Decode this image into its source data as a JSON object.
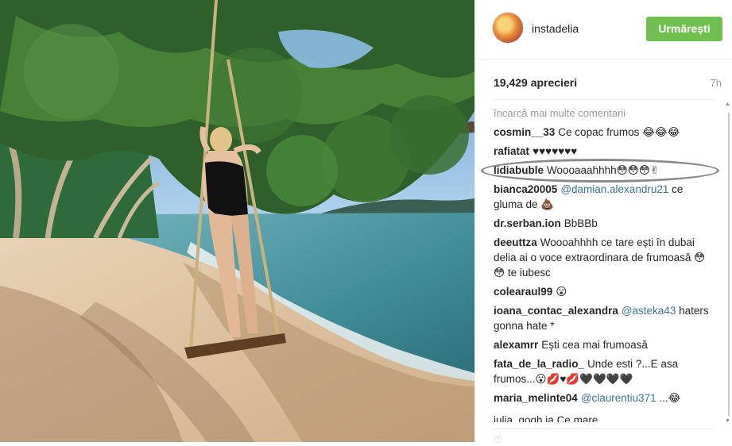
{
  "post": {
    "username": "instadelia",
    "follow_label": "Urmărești",
    "likes": "19,429 aprecieri",
    "time_ago": "7h",
    "load_more": "încarcă mai multe comentarii"
  },
  "comments": [
    {
      "user": "cosmin__33",
      "text": "Ce copac frumos 😂😂😂"
    },
    {
      "user": "rafiatat",
      "text": "♥♥♥♥♥♥♥"
    },
    {
      "user": "lidiabuble",
      "text": "Woooaaahhhh😳😳😳✌"
    },
    {
      "user": "bianca20005",
      "mention": "@damian.alexandru21",
      "text": "ce gluma de 💩"
    },
    {
      "user": "dr.serban.ion",
      "text": "BbBBb"
    },
    {
      "user": "deeuttza",
      "text": "Woooahhhh ce tare ești în dubai delia ai o voce extraordinara de frumoasă 😳 😳 te iubesc"
    },
    {
      "user": "colearaul99",
      "text": "😮"
    },
    {
      "user": "ioana_contac_alexandra",
      "mention": "@asteka43",
      "text": "haters gonna hate *"
    },
    {
      "user": "alexamrr",
      "text": "Ești cea mai frumoasă"
    },
    {
      "user": "fata_de_la_radio_",
      "text": "Unde esti ?...E asa frumos...😮💋♥💋🖤🖤🖤🖤"
    },
    {
      "user": "maria_melinte04",
      "mention": "@claurentiu371",
      "text": "...😂"
    }
  ],
  "partial_row": "iulia_gogh.ia Ce mare ...",
  "icons": {
    "avatar": "avatar",
    "heart": "heart-icon",
    "comment": "comment-icon"
  },
  "colors": {
    "follow_button": "#70c050",
    "mention": "#3f729b"
  }
}
